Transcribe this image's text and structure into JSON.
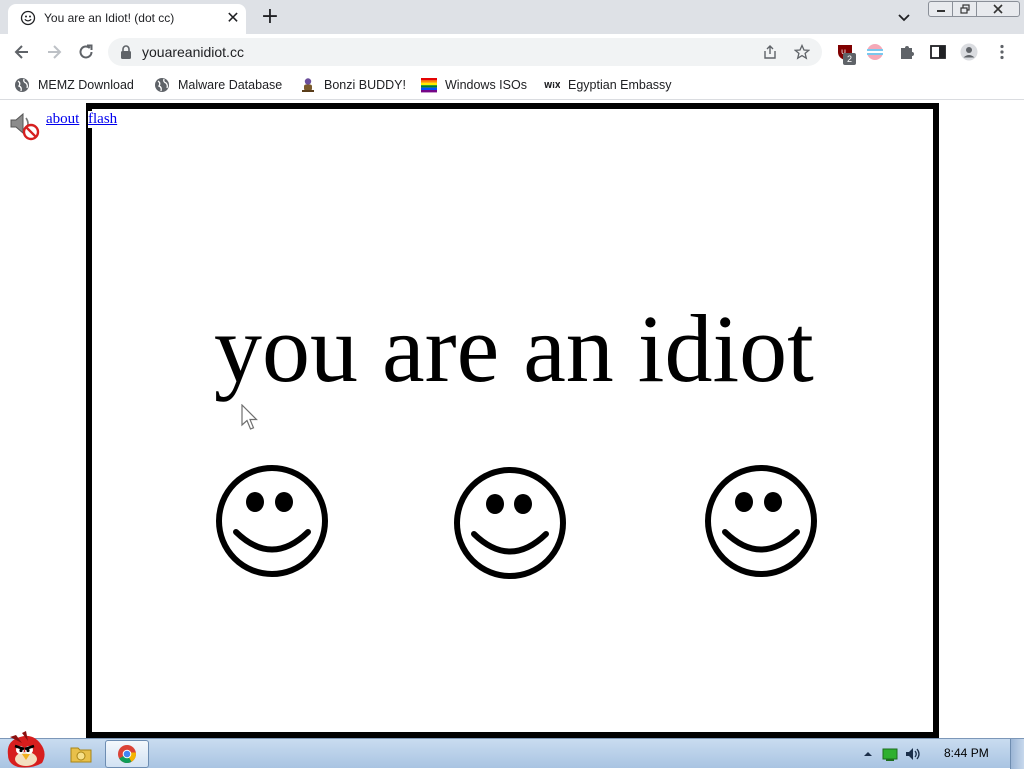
{
  "browser": {
    "tab": {
      "title": "You are an Idiot! (dot cc)",
      "favicon": "smiley-icon",
      "close_glyph": "✕"
    },
    "new_tab_glyph": "+",
    "window_controls": [
      "minimize",
      "maximize",
      "close"
    ],
    "address": {
      "url": "youareanidiot.cc"
    },
    "toolbar_icons": [
      "back-icon",
      "forward-icon",
      "reload-icon",
      "lock-icon",
      "share-icon",
      "star-icon",
      "ublock-icon",
      "extension-icon",
      "puzzle-icon",
      "sidepanel-icon",
      "profile-icon",
      "menu-icon"
    ],
    "extension_badge": "2",
    "bookmarks": [
      {
        "label": "MEMZ Download",
        "icon": "globe-icon"
      },
      {
        "label": "Malware Database",
        "icon": "globe-icon"
      },
      {
        "label": "Bonzi BUDDY!",
        "icon": "bonzi-icon"
      },
      {
        "label": "Windows ISOs",
        "icon": "rainbow-flag-icon"
      },
      {
        "label": "Egyptian Embassy",
        "icon": "wix-icon"
      }
    ]
  },
  "page": {
    "links": {
      "about": "about",
      "flash": "flash"
    },
    "headline": "you are an idiot",
    "smiley_count": 3
  },
  "taskbar": {
    "clock": "8:44 PM",
    "accent": "#a9c4e2"
  }
}
